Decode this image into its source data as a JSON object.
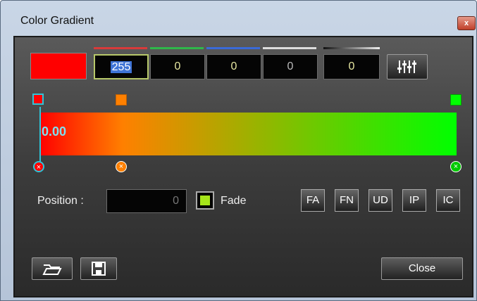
{
  "window": {
    "title": "Color Gradient",
    "close_glyph": "x"
  },
  "color": {
    "swatch": "#ff0000",
    "channels": [
      {
        "name": "red",
        "value": "255",
        "bar": "#d83a3a"
      },
      {
        "name": "green",
        "value": "0",
        "bar": "#2fb84a"
      },
      {
        "name": "blue",
        "value": "0",
        "bar": "#3a6ad8"
      },
      {
        "name": "white",
        "value": "0",
        "bar": "#dddddd"
      }
    ],
    "extra_value": "0",
    "mixer_icon": "sliders-icon"
  },
  "gradient": {
    "position_text": "0.00",
    "stops": [
      {
        "color": "#ff0000",
        "selected": true
      },
      {
        "color": "#ff8000",
        "selected": false
      },
      {
        "color": "#00ff00",
        "selected": false
      }
    ]
  },
  "controls": {
    "position_label": "Position :",
    "position_value": "0",
    "fade_label": "Fade",
    "fade_checked": true,
    "buttons": [
      "FA",
      "FN",
      "UD",
      "IP",
      "IC"
    ]
  },
  "footer": {
    "open_icon": "folder-open-icon",
    "save_icon": "floppy-disk-icon",
    "close_label": "Close"
  }
}
